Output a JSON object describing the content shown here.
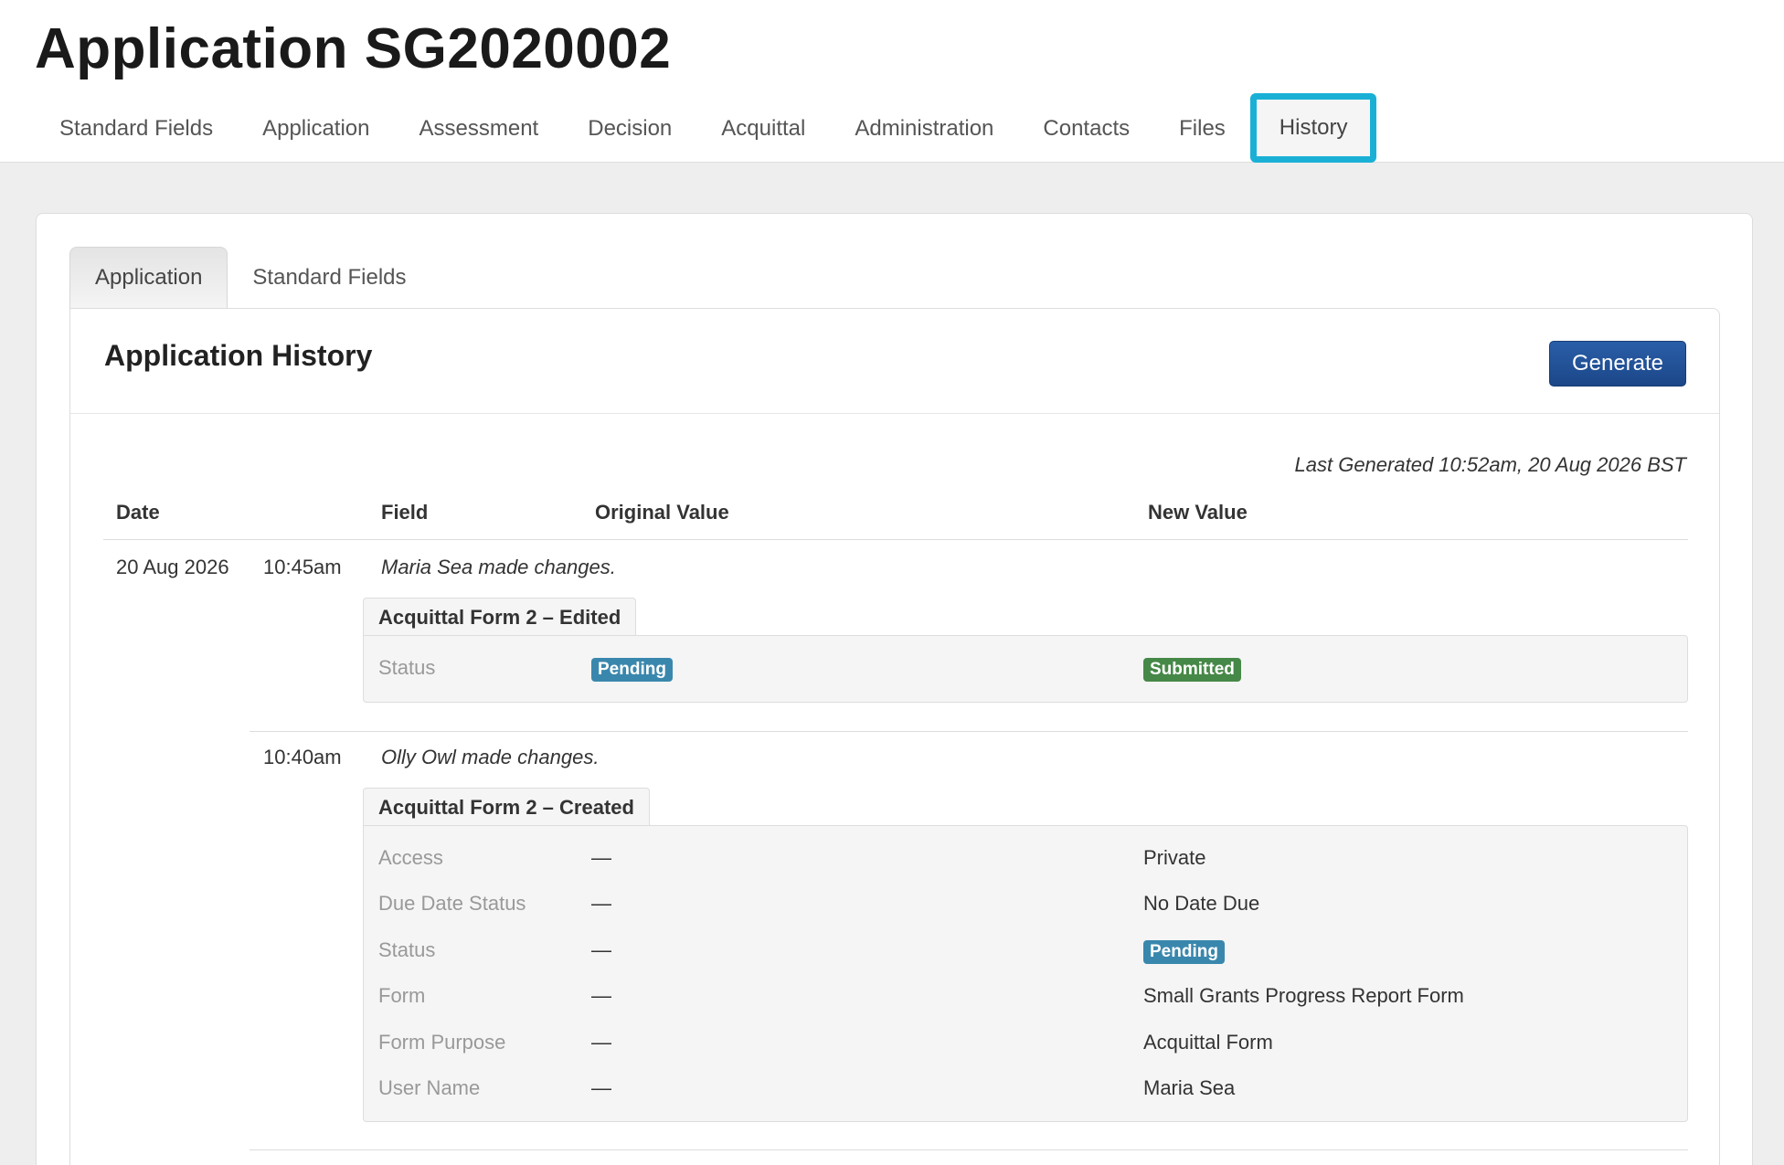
{
  "page": {
    "title": "Application SG2020002"
  },
  "main_tabs": [
    {
      "label": "Standard Fields"
    },
    {
      "label": "Application"
    },
    {
      "label": "Assessment"
    },
    {
      "label": "Decision"
    },
    {
      "label": "Acquittal"
    },
    {
      "label": "Administration"
    },
    {
      "label": "Contacts"
    },
    {
      "label": "Files"
    },
    {
      "label": "History",
      "active": true
    }
  ],
  "sub_tabs": [
    {
      "label": "Application",
      "active": true
    },
    {
      "label": "Standard Fields"
    }
  ],
  "history": {
    "title": "Application History",
    "generate_label": "Generate",
    "last_generated": "Last Generated 10:52am, 20 Aug 2026 BST",
    "columns": {
      "date": "Date",
      "field": "Field",
      "original": "Original Value",
      "new": "New Value"
    },
    "date": "20 Aug 2026",
    "entries": [
      {
        "time": "10:45am",
        "summary": "Maria Sea made changes.",
        "form_label": "Acquittal Form 2 – Edited",
        "rows": [
          {
            "field": "Status",
            "original": "Pending",
            "new": "Submitted"
          }
        ]
      },
      {
        "time": "10:40am",
        "summary": "Olly Owl made changes.",
        "form_label": "Acquittal Form 2 – Created",
        "rows": [
          {
            "field": "Access",
            "original": "—",
            "new": "Private"
          },
          {
            "field": "Due Date Status",
            "original": "—",
            "new": "No Date Due"
          },
          {
            "field": "Status",
            "original": "—",
            "new": "Pending"
          },
          {
            "field": "Form",
            "original": "—",
            "new": "Small Grants Progress Report Form"
          },
          {
            "field": "Form Purpose",
            "original": "—",
            "new": "Acquittal Form"
          },
          {
            "field": "User Name",
            "original": "—",
            "new": "Maria Sea"
          }
        ]
      }
    ]
  },
  "colors": {
    "highlight": "#1ab0d6",
    "button": "#1c4788",
    "badge_pending": "#3a87ad",
    "badge_submitted": "#468847"
  }
}
